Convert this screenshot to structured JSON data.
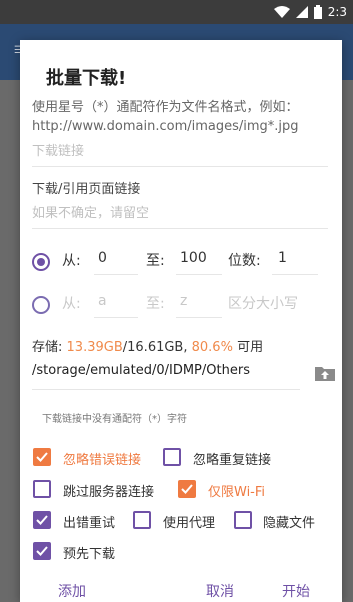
{
  "status_bar": {
    "time": "2:3",
    "icons": [
      "wifi-icon",
      "signal-icon",
      "battery-icon"
    ]
  },
  "dialog": {
    "title": "批量下载!",
    "hint_line1": "使用星号（*）通配符作为文件名格式，例如：",
    "hint_line2": "http://www.domain.com/images/img*.jpg",
    "download_link_placeholder": "下载链接",
    "referer_label": "下载/引用页面链接",
    "referer_placeholder": "如果不确定，请留空",
    "range_numeric": {
      "from_label": "从:",
      "from_value": "0",
      "to_label": "至:",
      "to_value": "100",
      "digits_label": "位数:",
      "digits_value": "1"
    },
    "range_alpha": {
      "from_label": "从:",
      "from_value": "a",
      "to_label": "至:",
      "to_value": "z",
      "case_label": "区分大小写"
    },
    "storage": {
      "label": "存储:",
      "free": "13.39GB",
      "sep": "/",
      "total": "16.61GB,",
      "percent": "80.6%",
      "suffix": "可用"
    },
    "path": "/storage/emulated/0/IDMP/Others",
    "note": "下载链接中没有通配符（*）字符",
    "options": {
      "ignore_error_links": "忽略错误链接",
      "ignore_duplicate_links": "忽略重复链接",
      "skip_server_connect": "跳过服务器连接",
      "wifi_only": "仅限Wi-Fi",
      "retry_on_error": "出错重试",
      "use_proxy": "使用代理",
      "hide_files": "隐藏文件",
      "predownload": "预先下载"
    },
    "buttons": {
      "add": "添加",
      "cancel": "取消",
      "start": "开始"
    }
  },
  "colors": {
    "accent": "#6f51a6",
    "orange": "#ef7a41",
    "appbar": "#2b4a73"
  }
}
